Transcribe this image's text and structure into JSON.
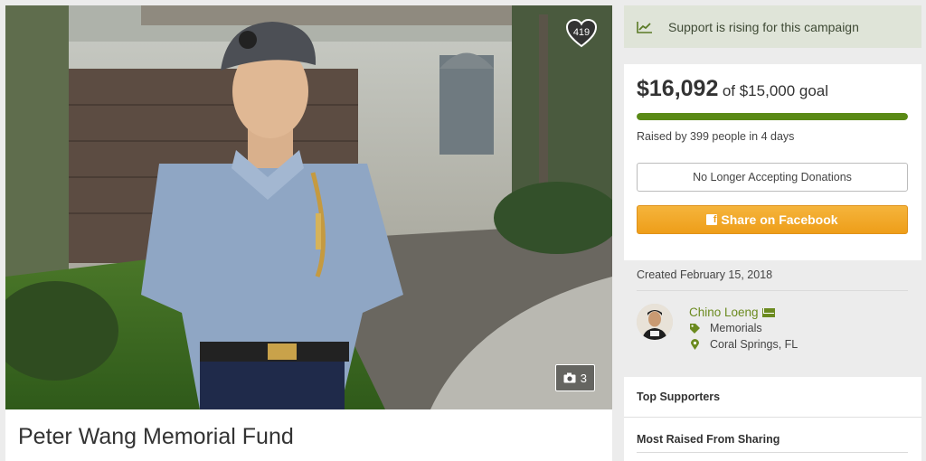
{
  "campaign": {
    "title": "Peter Wang Memorial Fund",
    "heart_count": "419",
    "photo_count": "3",
    "image_description_icon": "camera-icon"
  },
  "rising": {
    "icon": "trend-up-icon",
    "text": "Support is rising for this campaign"
  },
  "funding": {
    "raised": "$16,092",
    "goal_text": "of $15,000 goal",
    "progress_fraction": 1.0,
    "raised_by": "Raised by 399 people in 4 days",
    "no_donations_label": "No Longer Accepting Donations",
    "share_button_label": "Share on Facebook",
    "progress_color": "#5a8a16",
    "button_color": "#f0a324"
  },
  "details": {
    "created": "Created February 15, 2018",
    "organizer_name": "Chino Loeng",
    "category": "Memorials",
    "location": "Coral Springs, FL",
    "accent_color": "#6b8a1f"
  },
  "sections": {
    "top_supporters": "Top Supporters",
    "most_raised_sharing": "Most Raised From Sharing"
  }
}
